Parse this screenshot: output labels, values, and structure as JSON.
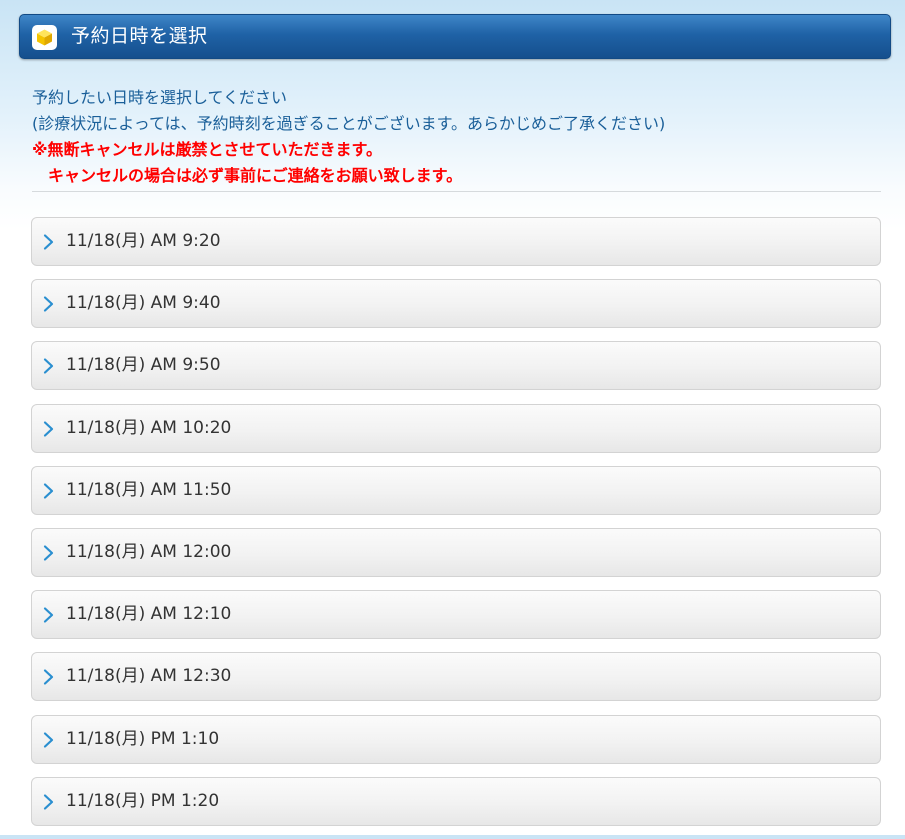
{
  "header": {
    "title": "予約日時を選択",
    "icon": "yellow-cube-icon"
  },
  "intro": {
    "line1": "予約したい日時を選択してください",
    "line2": "(診療状況によっては、予約時刻を過ぎることがございます。あらかじめご了承ください)",
    "warning1": "※無断キャンセルは厳禁とさせていただきます。",
    "warning2": "キャンセルの場合は必ず事前にご連絡をお願い致します。"
  },
  "colors": {
    "header_bg": "#1f62a6",
    "intro_text": "#1a5f99",
    "warning_text": "#ff0000",
    "chevron": "#2a8fd0"
  },
  "slots": [
    {
      "label": "11/18(月) AM 9:20"
    },
    {
      "label": "11/18(月) AM 9:40"
    },
    {
      "label": "11/18(月) AM 9:50"
    },
    {
      "label": "11/18(月) AM 10:20"
    },
    {
      "label": "11/18(月) AM 11:50"
    },
    {
      "label": "11/18(月) AM 12:00"
    },
    {
      "label": "11/18(月) AM 12:10"
    },
    {
      "label": "11/18(月) AM 12:30"
    },
    {
      "label": "11/18(月) PM 1:10"
    },
    {
      "label": "11/18(月) PM 1:20"
    }
  ]
}
